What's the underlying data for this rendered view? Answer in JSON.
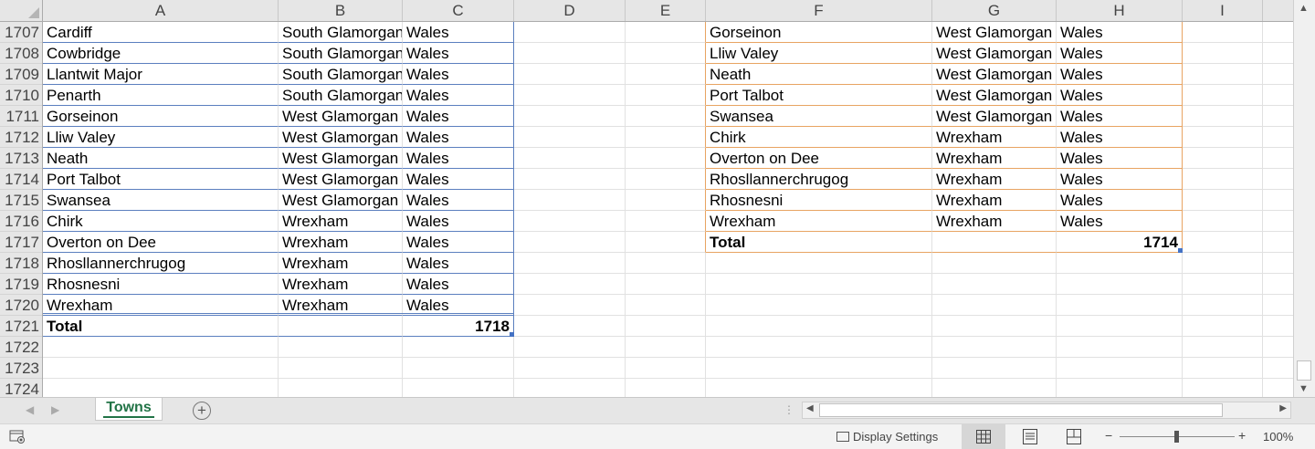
{
  "columns": [
    "A",
    "B",
    "C",
    "D",
    "E",
    "F",
    "G",
    "H",
    "I"
  ],
  "row_numbers": [
    "1707",
    "1708",
    "1709",
    "1710",
    "1711",
    "1712",
    "1713",
    "1714",
    "1715",
    "1716",
    "1717",
    "1718",
    "1719",
    "1720",
    "1721",
    "1722",
    "1723",
    "1724"
  ],
  "table_left": {
    "rows": [
      [
        "Cardiff",
        "South Glamorgan",
        "Wales"
      ],
      [
        "Cowbridge",
        "South Glamorgan",
        "Wales"
      ],
      [
        "Llantwit Major",
        "South Glamorgan",
        "Wales"
      ],
      [
        "Penarth",
        "South Glamorgan",
        "Wales"
      ],
      [
        "Gorseinon",
        "West Glamorgan",
        "Wales"
      ],
      [
        "Lliw Valey",
        "West Glamorgan",
        "Wales"
      ],
      [
        "Neath",
        "West Glamorgan",
        "Wales"
      ],
      [
        "Port Talbot",
        "West Glamorgan",
        "Wales"
      ],
      [
        "Swansea",
        "West Glamorgan",
        "Wales"
      ],
      [
        "Chirk",
        "Wrexham",
        "Wales"
      ],
      [
        "Overton on Dee",
        "Wrexham",
        "Wales"
      ],
      [
        "Rhosllannerchrugog",
        "Wrexham",
        "Wales"
      ],
      [
        "Rhosnesni",
        "Wrexham",
        "Wales"
      ],
      [
        "Wrexham",
        "Wrexham",
        "Wales"
      ]
    ],
    "total_label": "Total",
    "total_value": "1718"
  },
  "table_right": {
    "rows": [
      [
        "Gorseinon",
        "West Glamorgan",
        "Wales"
      ],
      [
        "Lliw Valey",
        "West Glamorgan",
        "Wales"
      ],
      [
        "Neath",
        "West Glamorgan",
        "Wales"
      ],
      [
        "Port Talbot",
        "West Glamorgan",
        "Wales"
      ],
      [
        "Swansea",
        "West Glamorgan",
        "Wales"
      ],
      [
        "Chirk",
        "Wrexham",
        "Wales"
      ],
      [
        "Overton on Dee",
        "Wrexham",
        "Wales"
      ],
      [
        "Rhosllannerchrugog",
        "Wrexham",
        "Wales"
      ],
      [
        "Rhosnesni",
        "Wrexham",
        "Wales"
      ],
      [
        "Wrexham",
        "Wrexham",
        "Wales"
      ]
    ],
    "total_label": "Total",
    "total_value": "1714"
  },
  "sheet_tabs": [
    {
      "label": "Towns",
      "active": true
    }
  ],
  "status": {
    "display_settings": "Display Settings",
    "zoom": "100%"
  },
  "colors": {
    "table_left_border": "#5b7fbf",
    "table_right_border": "#e8a462",
    "active_tab": "#217346"
  },
  "icons": [
    "select-all-icon",
    "scroll-up-icon",
    "scroll-down-icon",
    "add-sheet-icon",
    "normal-view-icon",
    "page-layout-icon",
    "page-break-icon",
    "macro-record-icon"
  ]
}
